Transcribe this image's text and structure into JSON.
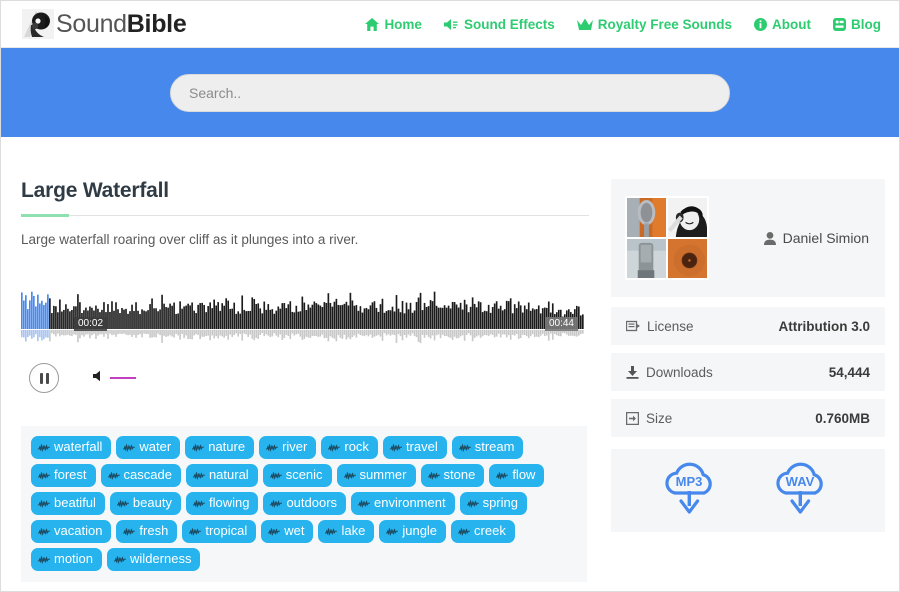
{
  "brand": {
    "logo_icon": "soundbible-portrait-logo",
    "name_thin": "Sound",
    "name_bold": "Bible"
  },
  "nav": {
    "items": [
      {
        "label": "Home",
        "icon": "home-icon"
      },
      {
        "label": "Sound Effects",
        "icon": "volume-music-icon"
      },
      {
        "label": "Royalty Free Sounds",
        "icon": "crown-icon"
      },
      {
        "label": "About",
        "icon": "info-circle-icon"
      },
      {
        "label": "Blog",
        "icon": "blog-icon"
      }
    ],
    "color": "#2ecc71"
  },
  "search": {
    "placeholder": "Search..",
    "value": "",
    "banner_color": "#4788ec"
  },
  "sound": {
    "title": "Large Waterfall",
    "description": "Large waterfall roaring over cliff as it plunges into a river.",
    "accent_color": "#8fe0b0"
  },
  "player": {
    "current_time": "00:02",
    "total_time": "00:44",
    "play_state": "pause",
    "played_color": "#4788ec",
    "wave_color": "#1b1b1b",
    "volume_color": "#c13fc1",
    "volume_icon": "speaker-icon",
    "pause_icon": "pause-icon"
  },
  "tags": [
    "waterfall",
    "water",
    "nature",
    "river",
    "rock",
    "travel",
    "stream",
    "forest",
    "cascade",
    "natural",
    "scenic",
    "summer",
    "stone",
    "flow",
    "beatiful",
    "beauty",
    "flowing",
    "outdoors",
    "environment",
    "spring",
    "vacation",
    "fresh",
    "tropical",
    "wet",
    "lake",
    "jungle",
    "creek",
    "motion",
    "wilderness"
  ],
  "tag_style": {
    "icon": "waveform-icon",
    "color": "#26b3ee"
  },
  "author": {
    "name": "Daniel Simion",
    "icon": "user-icon",
    "photos": [
      {
        "name": "vintage-microphone-photo"
      },
      {
        "name": "woman-headphones-photo"
      },
      {
        "name": "studio-microphone-photo"
      },
      {
        "name": "vinyl-record-photo"
      }
    ]
  },
  "info_rows": [
    {
      "label": "License",
      "value": "Attribution 3.0",
      "icon": "license-icon"
    },
    {
      "label": "Downloads",
      "value": "54,444",
      "icon": "download-icon"
    },
    {
      "label": "Size",
      "value": "0.760MB",
      "icon": "size-icon"
    }
  ],
  "downloads": {
    "mp3_label": "MP3",
    "wav_label": "WAV",
    "icon": "cloud-download-icon",
    "color": "#4788ec"
  }
}
